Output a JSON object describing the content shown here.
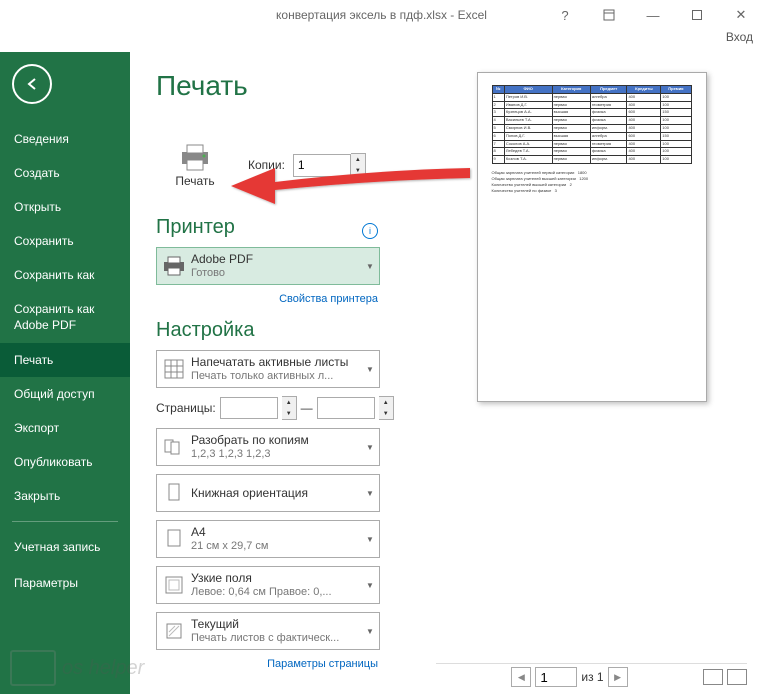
{
  "titlebar": {
    "title": "конвертация эксель в пдф.xlsx - Excel"
  },
  "signin": "Вход",
  "sidebar": {
    "items": [
      {
        "label": "Сведения"
      },
      {
        "label": "Создать"
      },
      {
        "label": "Открыть"
      },
      {
        "label": "Сохранить"
      },
      {
        "label": "Сохранить как"
      },
      {
        "label": "Сохранить как Adobe PDF"
      },
      {
        "label": "Печать"
      },
      {
        "label": "Общий доступ"
      },
      {
        "label": "Экспорт"
      },
      {
        "label": "Опубликовать"
      },
      {
        "label": "Закрыть"
      },
      {
        "label": "Учетная запись"
      },
      {
        "label": "Параметры"
      }
    ]
  },
  "main": {
    "title": "Печать",
    "print_btn": "Печать",
    "copies_label": "Копии:",
    "copies_value": "1",
    "printer_section": "Принтер",
    "printer": {
      "name": "Adobe PDF",
      "status": "Готово"
    },
    "printer_props": "Свойства принтера",
    "settings_section": "Настройка",
    "setting_sheets": {
      "primary": "Напечатать активные листы",
      "secondary": "Печать только активных л..."
    },
    "pages_label": "Страницы:",
    "pages_sep": "—",
    "collate": {
      "primary": "Разобрать по копиям",
      "secondary": "1,2,3   1,2,3   1,2,3"
    },
    "orientation": {
      "primary": "Книжная ориентация",
      "secondary": ""
    },
    "paper": {
      "primary": "A4",
      "secondary": "21 см x 29,7 см"
    },
    "margins": {
      "primary": "Узкие поля",
      "secondary": "Левое:  0,64 см   Правое:  0,..."
    },
    "scaling": {
      "primary": "Текущий",
      "secondary": "Печать листов с фактическ..."
    },
    "page_setup": "Параметры страницы"
  },
  "nav": {
    "current": "1",
    "of_label": "из 1"
  }
}
